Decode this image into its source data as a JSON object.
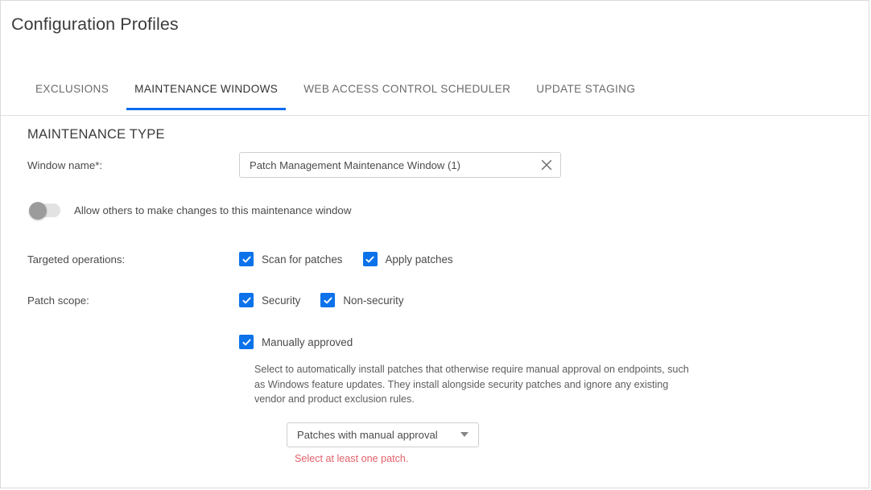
{
  "header": {
    "title": "Configuration Profiles"
  },
  "tabs": [
    {
      "label": "EXCLUSIONS",
      "active": false
    },
    {
      "label": "MAINTENANCE WINDOWS",
      "active": true
    },
    {
      "label": "WEB ACCESS CONTROL SCHEDULER",
      "active": false
    },
    {
      "label": "UPDATE STAGING",
      "active": false
    }
  ],
  "main": {
    "section_title": "MAINTENANCE TYPE",
    "window_name": {
      "label": "Window name*:",
      "value": "Patch Management Maintenance Window (1)",
      "placeholder": "Window name",
      "clear_icon": "close-icon"
    },
    "allow_others": {
      "label": "Allow others to make changes to this maintenance window",
      "checked": false
    },
    "targeted_operations": {
      "label": "Targeted operations:",
      "options": [
        {
          "label": "Scan for patches",
          "checked": true
        },
        {
          "label": "Apply patches",
          "checked": true
        }
      ]
    },
    "patch_scope": {
      "label": "Patch scope:",
      "options": [
        {
          "label": "Security",
          "checked": true
        },
        {
          "label": "Non-security",
          "checked": true
        }
      ]
    },
    "manually_approved": {
      "label": "Manually approved",
      "checked": true,
      "description": "Select to automatically install patches that otherwise require manual approval on endpoints, such as Windows feature updates. They install alongside security patches and ignore any existing vendor and product exclusion rules.",
      "select": {
        "value": "Patches with manual approval",
        "caret_icon": "chevron-down-icon"
      },
      "error": "Select at least one patch."
    }
  },
  "colors": {
    "accent": "#0b6cf0",
    "checkbox": "#0b72ea",
    "error": "#e2616a",
    "border": "#dadada"
  }
}
